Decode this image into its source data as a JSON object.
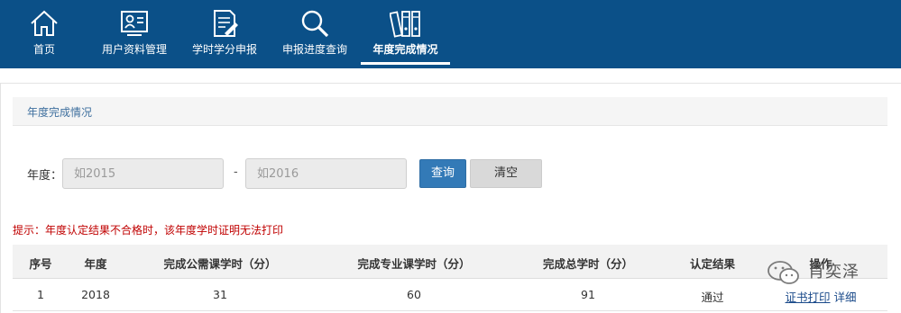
{
  "nav": {
    "items": [
      {
        "label": "首页",
        "icon": "home-icon"
      },
      {
        "label": "用户资料管理",
        "icon": "user-card-icon"
      },
      {
        "label": "学时学分申报",
        "icon": "document-edit-icon"
      },
      {
        "label": "申报进度查询",
        "icon": "magnifier-icon"
      },
      {
        "label": "年度完成情况",
        "icon": "binders-icon"
      }
    ],
    "active": "年度完成情况"
  },
  "section": {
    "title": "年度完成情况"
  },
  "filter": {
    "year_label": "年度：",
    "from_placeholder": "如2015",
    "to_placeholder": "如2016",
    "separator": "-",
    "query_label": "查询",
    "clear_label": "清空"
  },
  "tip": "提示：年度认定结果不合格时，该年度学时证明无法打印",
  "table": {
    "headers": [
      "序号",
      "年度",
      "完成公需课学时（分）",
      "完成专业课学时（分）",
      "完成总学时（分）",
      "认定结果",
      "操作"
    ],
    "rows": [
      {
        "no": "1",
        "year": "2018",
        "public_hours": "31",
        "major_hours": "60",
        "total_hours": "91",
        "result": "通过",
        "action_print": "证书打印",
        "action_detail": "详细"
      }
    ]
  },
  "watermark": {
    "text": "肖奕泽",
    "icon": "wechat-icon"
  },
  "colors": {
    "nav_bg": "#0b5088",
    "primary": "#337ab7",
    "tip": "#c00000"
  }
}
